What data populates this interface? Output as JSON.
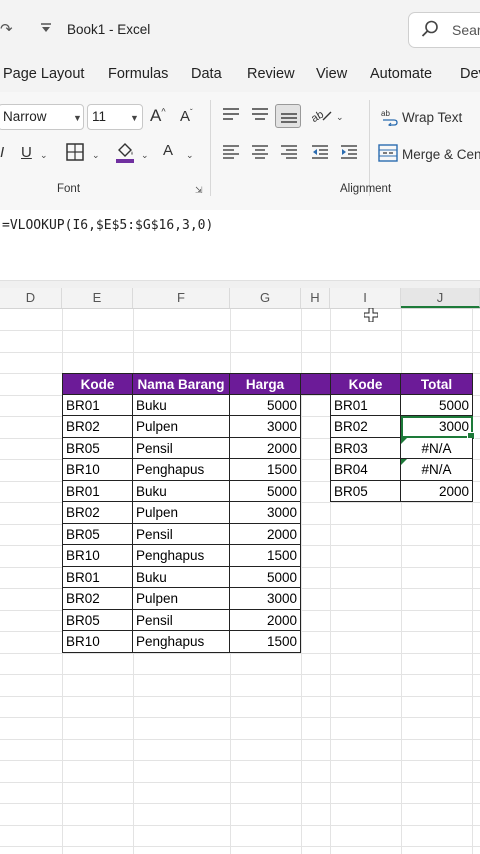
{
  "title_bar": {
    "title": "Book1  -  Excel",
    "search_placeholder": "Sear",
    "search_icon": "search-icon",
    "redo_glyph": "↷",
    "customize_glyph": "⏷"
  },
  "tabs": [
    "Page Layout",
    "Formulas",
    "Data",
    "Review",
    "View",
    "Automate",
    "Dev"
  ],
  "ribbon": {
    "font_name": "Narrow",
    "font_size": "11",
    "grow_font": "A",
    "shrink_font": "A",
    "underline": "U",
    "italic_partial": "I",
    "font_color_letter": "A",
    "font_group_label": "Font",
    "wrap_text": "Wrap Text",
    "merge_center": "Merge & Cen",
    "alignment_group_label": "Alignment",
    "fill_color": "#7030a0",
    "font_color": "#c00000"
  },
  "formula_bar": {
    "formula": "=VLOOKUP(I6,$E$5:$G$16,3,0)"
  },
  "columns": [
    "D",
    "E",
    "F",
    "G",
    "H",
    "I",
    "J"
  ],
  "left_table": {
    "headers": [
      "Kode",
      "Nama Barang",
      "Harga"
    ],
    "rows": [
      [
        "BR01",
        "Buku",
        "5000"
      ],
      [
        "BR02",
        "Pulpen",
        "3000"
      ],
      [
        "BR05",
        "Pensil",
        "2000"
      ],
      [
        "BR10",
        "Penghapus",
        "1500"
      ],
      [
        "BR01",
        "Buku",
        "5000"
      ],
      [
        "BR02",
        "Pulpen",
        "3000"
      ],
      [
        "BR05",
        "Pensil",
        "2000"
      ],
      [
        "BR10",
        "Penghapus",
        "1500"
      ],
      [
        "BR01",
        "Buku",
        "5000"
      ],
      [
        "BR02",
        "Pulpen",
        "3000"
      ],
      [
        "BR05",
        "Pensil",
        "2000"
      ],
      [
        "BR10",
        "Penghapus",
        "1500"
      ]
    ]
  },
  "right_table": {
    "headers": [
      "Kode",
      "Total"
    ],
    "rows": [
      [
        "BR01",
        "5000"
      ],
      [
        "BR02",
        "3000"
      ],
      [
        "BR03",
        "#N/A"
      ],
      [
        "BR04",
        "#N/A"
      ],
      [
        "BR05",
        "2000"
      ]
    ]
  },
  "colors": {
    "header_fill": "#6c1b98",
    "selection": "#1d7a39"
  }
}
